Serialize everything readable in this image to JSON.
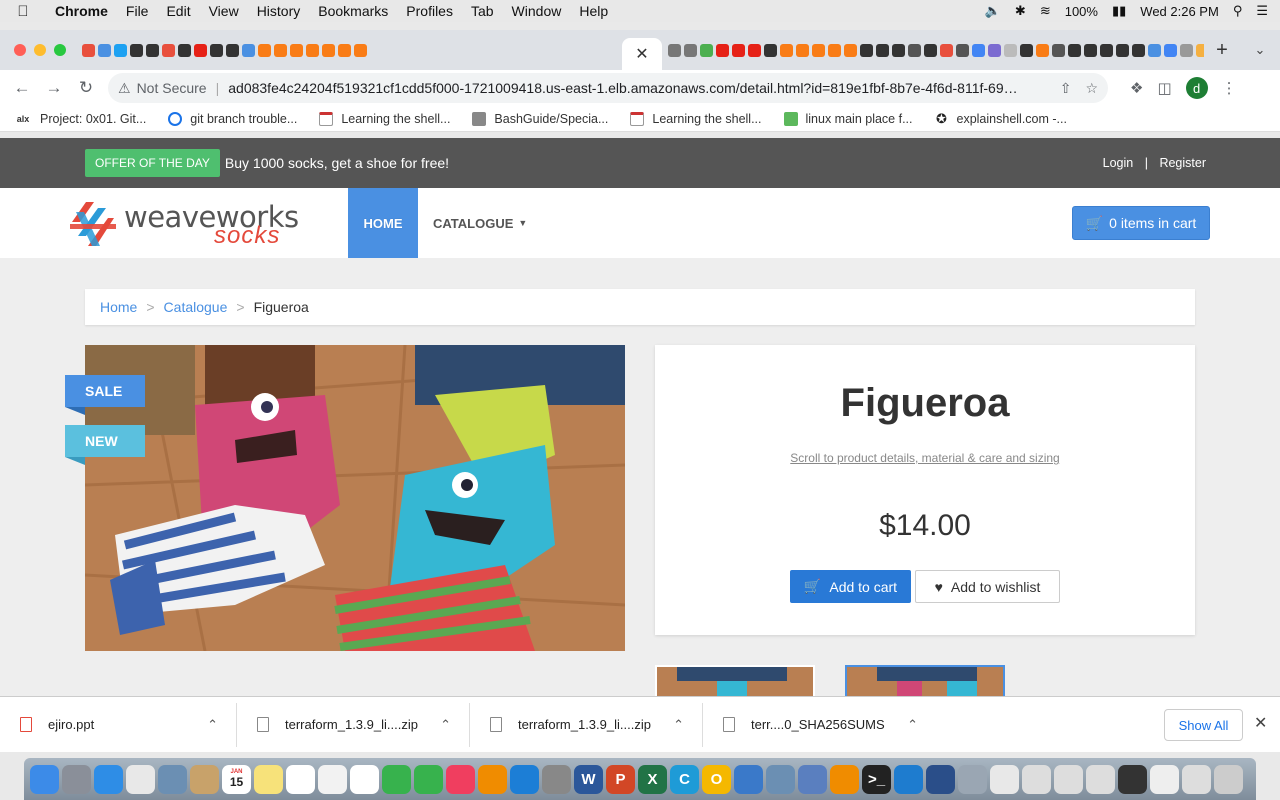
{
  "menubar": {
    "app": "Chrome",
    "items": [
      "File",
      "Edit",
      "View",
      "History",
      "Bookmarks",
      "Profiles",
      "Tab",
      "Window",
      "Help"
    ],
    "battery": "100%",
    "clock": "Wed 2:26 PM"
  },
  "tabs": {
    "favicon_colors": [
      "#e84f3d",
      "#4a90e2",
      "#1da1f2",
      "#333",
      "#333",
      "#e84f3d",
      "#333",
      "#e62117",
      "#333",
      "#333",
      "#4a90e2",
      "#f97c16",
      "#f97c16",
      "#f97c16",
      "#f97c16",
      "#f97c16",
      "#f97c16",
      "#f97c16"
    ],
    "favicon_colors_after": [
      "#777",
      "#777",
      "#4caf50",
      "#e62117",
      "#e62117",
      "#e62117",
      "#333",
      "#f97c16",
      "#f97c16",
      "#f97c16",
      "#f97c16",
      "#f97c16",
      "#333",
      "#333",
      "#333",
      "#555",
      "#333",
      "#e84f3d",
      "#555",
      "#4285f4",
      "#7b6bd1",
      "#bbb",
      "#333",
      "#f97c16",
      "#555",
      "#333",
      "#333",
      "#333",
      "#333",
      "#333",
      "#4a90e2",
      "#4285f4",
      "#999",
      "#f5b041",
      "#333",
      "#333",
      "#e2632a",
      "#4285f4",
      "#333"
    ],
    "active_close": "✕",
    "new_tab": "+"
  },
  "omnibox": {
    "security": "Not Secure",
    "url": "ad083fe4c24204f519321cf1cdd5f000-1721009418.us-east-1.elb.amazonaws.com/detail.html?id=819e1fbf-8b7e-4f6d-811f-69…"
  },
  "account_initial": "d",
  "bookmarks": [
    {
      "label": "Project: 0x01. Git...",
      "icon": "alx"
    },
    {
      "label": "git branch trouble...",
      "icon": "git"
    },
    {
      "label": "Learning the shell...",
      "icon": "doc"
    },
    {
      "label": "BashGuide/Specia...",
      "icon": "cat"
    },
    {
      "label": "Learning the shell...",
      "icon": "doc"
    },
    {
      "label": "linux main place f...",
      "icon": "leaf"
    },
    {
      "label": "explainshell.com -...",
      "icon": "shell"
    }
  ],
  "site": {
    "offer_badge": "OFFER OF THE DAY",
    "offer_text": "Buy 1000 socks, get a shoe for free!",
    "login": "Login",
    "register": "Register",
    "auth_sep": "|",
    "logo_top": "weaveworks",
    "logo_bottom": "socks",
    "nav_home": "HOME",
    "nav_catalogue": "CATALOGUE",
    "cart": "0 items in cart"
  },
  "breadcrumb": {
    "home": "Home",
    "catalogue": "Catalogue",
    "current": "Figueroa",
    "separator": ">"
  },
  "product": {
    "ribbon_sale": "SALE",
    "ribbon_new": "NEW",
    "name": "Figueroa",
    "scroll_link": "Scroll to product details, material & care and sizing",
    "price": "$14.00",
    "add_to_cart": "Add to cart",
    "add_to_wishlist": "Add to wishlist"
  },
  "downloads": {
    "items": [
      "ejiro.ppt",
      "terraform_1.3.9_li....zip",
      "terraform_1.3.9_li....zip",
      "terr....0_SHA256SUMS"
    ],
    "show_all": "Show All"
  },
  "dock": {
    "calendar_month": "JAN",
    "calendar_day": "15",
    "apps": [
      "finder-icon",
      "launchpad-icon",
      "safari-icon",
      "chrome-icon",
      "preview-icon",
      "contacts-icon",
      "calendar-icon",
      "notes-icon",
      "reminders-icon",
      "photos-icon",
      "textedit-icon",
      "messages-icon",
      "facetime-icon",
      "music-icon",
      "books-icon",
      "appstore-icon",
      "settings-icon",
      "word-icon",
      "powerpoint-icon",
      "excel-icon",
      "c-icon",
      "o-icon",
      "sourcetree-icon",
      "network-icon",
      "xcode-icon",
      "vlc-icon",
      "terminal-icon",
      "vscode-icon",
      "virtualbox-icon",
      "utility-icon",
      "files-icon",
      "window1-icon",
      "window2-icon",
      "window3-icon",
      "window4-icon",
      "window5-icon",
      "window6-icon",
      "trash-icon"
    ]
  }
}
